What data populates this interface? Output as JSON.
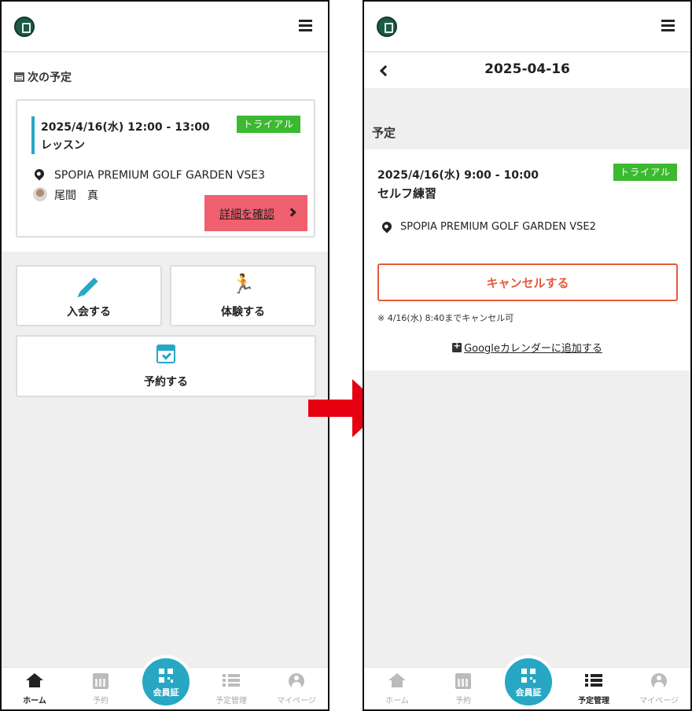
{
  "left": {
    "section_title": "次の予定",
    "card": {
      "datetime": "2025/4/16(水) 12:00 - 13:00",
      "type": "レッスン",
      "badge": "トライアル",
      "venue": "SPOPIA PREMIUM GOLF GARDEN VSE3",
      "coach": "尾間　真",
      "detail_button": "詳細を確認"
    },
    "tiles": {
      "join": "入会する",
      "trial": "体験する",
      "reserve": "予約する"
    },
    "nav": [
      {
        "label": "ホーム",
        "active": true
      },
      {
        "label": "予約",
        "active": false
      },
      {
        "label": "会員証",
        "active": false
      },
      {
        "label": "予定管理",
        "active": false
      },
      {
        "label": "マイページ",
        "active": false
      }
    ]
  },
  "right": {
    "page_title": "2025-04-16",
    "section_label": "予定",
    "detail": {
      "datetime": "2025/4/16(水) 9:00 - 10:00",
      "type": "セルフ練習",
      "badge": "トライアル",
      "venue": "SPOPIA PREMIUM GOLF GARDEN  VSE2",
      "cancel_button": "キャンセルする",
      "cancel_note": "※ 4/16(水) 8:40までキャンセル可",
      "gcal_link": "Googleカレンダーに追加する"
    },
    "nav": [
      {
        "label": "ホーム",
        "active": false
      },
      {
        "label": "予約",
        "active": false
      },
      {
        "label": "会員証",
        "active": false
      },
      {
        "label": "予定管理",
        "active": true
      },
      {
        "label": "マイページ",
        "active": false
      }
    ]
  },
  "colors": {
    "accent": "#27a7c4",
    "trial_badge": "#3cb930",
    "detail_button": "#f0606e",
    "cancel": "#e55a3a",
    "arrow": "#e60012"
  }
}
